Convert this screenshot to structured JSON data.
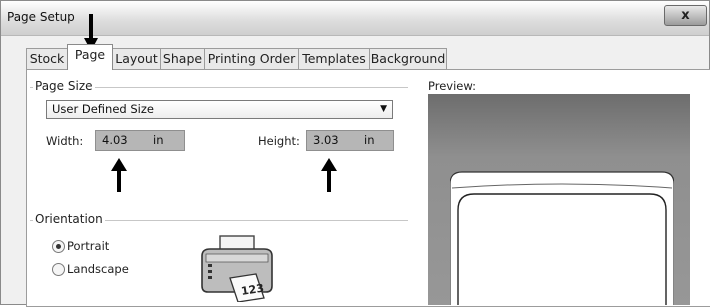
{
  "window": {
    "title": "Page Setup",
    "close_glyph": "x"
  },
  "tabs": [
    {
      "label": "Stock",
      "active": false
    },
    {
      "label": "Page",
      "active": true
    },
    {
      "label": "Layout",
      "active": false
    },
    {
      "label": "Shape",
      "active": false
    },
    {
      "label": "Printing Order",
      "active": false
    },
    {
      "label": "Templates",
      "active": false
    },
    {
      "label": "Background",
      "active": false
    }
  ],
  "page_size": {
    "group_title": "Page Size",
    "selected_size": "User Defined Size",
    "width_label": "Width:",
    "width_value": "4.03",
    "width_unit": "in",
    "height_label": "Height:",
    "height_value": "3.03",
    "height_unit": "in"
  },
  "orientation": {
    "group_title": "Orientation",
    "options": [
      {
        "label": "Portrait",
        "checked": true
      },
      {
        "label": "Landscape",
        "checked": false
      }
    ],
    "printer_label_text": "123"
  },
  "preview": {
    "label": "Preview:"
  },
  "colors": {
    "field_bg": "#b6b6b6",
    "preview_bg": "#8f8f8f",
    "arrow": "#000000"
  },
  "annotations": [
    "arrow-pointing-page-tab",
    "arrow-pointing-width-field",
    "arrow-pointing-height-field"
  ]
}
